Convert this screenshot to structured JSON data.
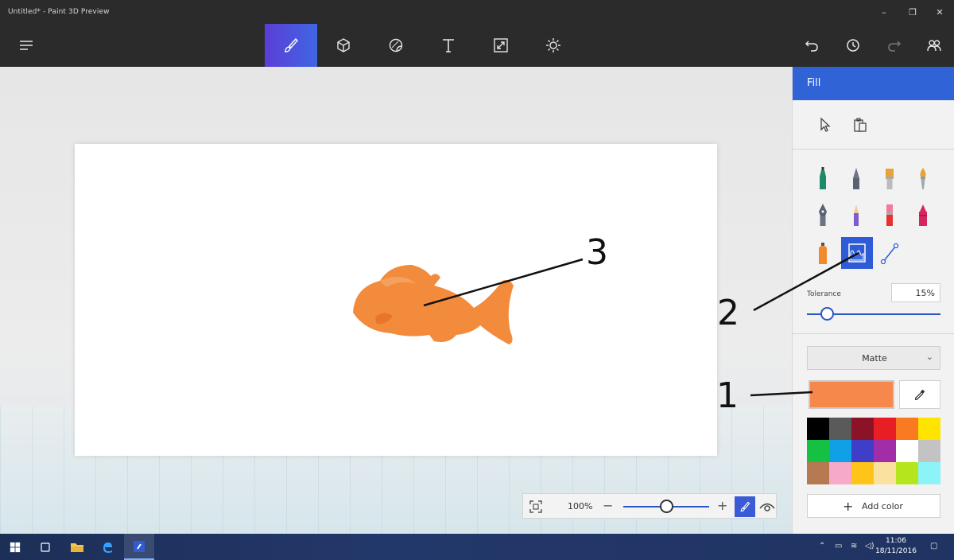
{
  "window": {
    "title": "Untitled* - Paint 3D Preview"
  },
  "toolbar": {
    "tools": [
      "art-tools",
      "3d-objects",
      "stickers",
      "text",
      "canvas",
      "effects"
    ],
    "active_tool": "art-tools"
  },
  "panel": {
    "title": "Fill",
    "tolerance_label": "Tolerance",
    "tolerance_value": "15%",
    "tolerance_fraction": 0.15,
    "finish": "Matte",
    "current_color": "#f5884a",
    "add_color_label": "Add color",
    "palette": [
      "#000000",
      "#5a5a5a",
      "#8b1325",
      "#e81e25",
      "#fa7a22",
      "#ffe400",
      "#16c043",
      "#0fa0e6",
      "#3e3ec8",
      "#a12ea8",
      "#ffffff",
      "#c3c3c3",
      "#b67a52",
      "#f6a9c8",
      "#ffc319",
      "#fbe1a0",
      "#b5e61d",
      "#8cf3f6"
    ]
  },
  "zoom": {
    "value": "100%"
  },
  "annotations": {
    "label_1": "1",
    "label_2": "2",
    "label_3": "3"
  },
  "taskbar": {
    "time": "11:06",
    "date": "18/11/2016"
  }
}
